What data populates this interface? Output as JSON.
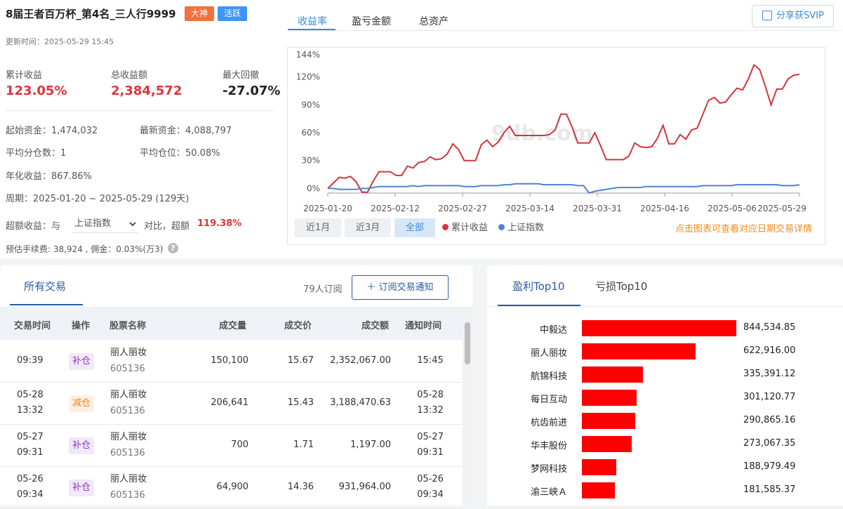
{
  "header": {
    "title": "8届王者百万杯_第4名_三人行9999",
    "badges": [
      "大神",
      "活跃"
    ],
    "updated": "更新时间：2025-05-29 15:45"
  },
  "kpis": [
    {
      "label": "累计收益",
      "value": "123.05%"
    },
    {
      "label": "总收益额",
      "value": "2,384,572"
    },
    {
      "label": "最大回撤",
      "value": "-27.07%"
    }
  ],
  "details": {
    "start_capital": "起始资金：1,474,032",
    "latest_capital": "最新资金：4,088,797",
    "avg_split": "平均分仓数：1",
    "avg_position": "平均仓位：50.08%",
    "annualized": "年化收益：867.86%",
    "period": "周期：2025-01-20 ~ 2025-05-29 (129天)",
    "excess_prefix": "超额收益：与",
    "benchmark": "上证指数",
    "excess_mid": "对比，超额",
    "excess_value": "119.38%",
    "fees": "预估手续费: 38,924 , 佣金：0.03%(万3)",
    "help": "?"
  },
  "chart_tabs": [
    "收益率",
    "盈亏金额",
    "总资产"
  ],
  "share_label": "分享获SVIP",
  "watermark": "9db.com",
  "range_buttons": [
    "近1月",
    "近3月",
    "全部"
  ],
  "legend": [
    {
      "name": "累计收益",
      "color": "#d2353d"
    },
    {
      "name": "上证指数",
      "color": "#4d84d0"
    }
  ],
  "chart_hint": "点击图表可查看对应日期交易详情",
  "chart_data": {
    "type": "line",
    "x_tick_labels": [
      "2025-01-20",
      "2025-02-12",
      "2025-02-27",
      "2025-03-14",
      "2025-03-31",
      "2025-04-16",
      "2025-05-06",
      "2025-05-29"
    ],
    "y_tick_labels": [
      "144%",
      "120%",
      "90%",
      "60%",
      "30%",
      "0%"
    ],
    "ylim": [
      -5,
      144
    ],
    "grid": false,
    "legend_position": "bottom-left",
    "series": [
      {
        "name": "累计收益",
        "color": "#d2353d",
        "values": [
          0,
          6,
          12,
          11,
          13,
          7,
          -4,
          -4,
          8,
          18,
          18,
          18,
          14,
          14,
          24,
          22,
          28,
          29,
          34,
          31,
          32,
          37,
          48,
          42,
          30,
          30,
          30,
          47,
          52,
          45,
          50,
          60,
          67,
          57,
          57,
          57,
          57,
          57,
          57,
          58,
          63,
          80,
          80,
          66,
          49,
          49,
          49,
          60,
          46,
          31,
          31,
          31,
          31,
          35,
          49,
          45,
          44,
          45,
          54,
          68,
          48,
          48,
          58,
          53,
          63,
          65,
          80,
          95,
          98,
          92,
          93,
          101,
          108,
          106,
          118,
          133,
          128,
          110,
          90,
          107,
          107,
          118,
          122,
          123
        ]
      },
      {
        "name": "上证指数",
        "color": "#4d84d0",
        "values": [
          0,
          0,
          -1,
          -1,
          -1,
          -1,
          0,
          0,
          1,
          2,
          2,
          2,
          2,
          2,
          2,
          3,
          2,
          3,
          3,
          3,
          3,
          3,
          3,
          3,
          2,
          2,
          2,
          3,
          3,
          3,
          3,
          4,
          4,
          5,
          5,
          5,
          5,
          5,
          4,
          4,
          4,
          4,
          4,
          4,
          3,
          3,
          -5,
          -3,
          -2,
          -1,
          0,
          1,
          1,
          1,
          1,
          1,
          2,
          2,
          2,
          2,
          2,
          2,
          2,
          2,
          2,
          2,
          3,
          3,
          3,
          3,
          3,
          3,
          4,
          4,
          4,
          4,
          4,
          4,
          4,
          4,
          3,
          3,
          3,
          4
        ]
      }
    ]
  },
  "trades": {
    "tab": "所有交易",
    "subscribers": "79人订阅",
    "subscribe_btn": "＋ 订阅交易通知",
    "headers": [
      "交易时间",
      "操作",
      "股票名称",
      "成交量",
      "成交价",
      "成交额",
      "通知时间"
    ],
    "rows": [
      {
        "time1": "09:39",
        "time2": "",
        "op": "补仓",
        "op_type": "add",
        "name": "丽人丽妆",
        "code": "605136",
        "volume": "150,100",
        "price": "15.67",
        "amount": "2,352,067.00",
        "ntime1": "15:45",
        "ntime2": ""
      },
      {
        "time1": "05-28",
        "time2": "13:32",
        "op": "减仓",
        "op_type": "cut",
        "name": "丽人丽妆",
        "code": "605136",
        "volume": "206,641",
        "price": "15.43",
        "amount": "3,188,470.63",
        "ntime1": "05-28",
        "ntime2": "13:32"
      },
      {
        "time1": "05-27",
        "time2": "09:31",
        "op": "补仓",
        "op_type": "add",
        "name": "丽人丽妆",
        "code": "605136",
        "volume": "700",
        "price": "1.71",
        "amount": "1,197.00",
        "ntime1": "05-27",
        "ntime2": "09:31"
      },
      {
        "time1": "05-26",
        "time2": "09:34",
        "op": "补仓",
        "op_type": "add",
        "name": "丽人丽妆",
        "code": "605136",
        "volume": "64,900",
        "price": "14.36",
        "amount": "931,964.00",
        "ntime1": "05-26",
        "ntime2": "09:34"
      }
    ]
  },
  "top10": {
    "tabs": [
      "盈利Top10",
      "亏损Top10"
    ],
    "bar_color": "#ff0000",
    "max": 844534.85,
    "items": [
      {
        "name": "中毅达",
        "value": 844534.85,
        "label": "844,534.85"
      },
      {
        "name": "丽人丽妆",
        "value": 622916.0,
        "label": "622,916.00"
      },
      {
        "name": "航锦科技",
        "value": 335391.12,
        "label": "335,391.12"
      },
      {
        "name": "每日互动",
        "value": 301120.77,
        "label": "301,120.77"
      },
      {
        "name": "杭齿前进",
        "value": 290865.16,
        "label": "290,865.16"
      },
      {
        "name": "华丰股份",
        "value": 273067.35,
        "label": "273,067.35"
      },
      {
        "name": "梦网科技",
        "value": 188979.49,
        "label": "188,979.49"
      },
      {
        "name": "渝三峡Ａ",
        "value": 181585.37,
        "label": "181,585.37"
      }
    ]
  }
}
